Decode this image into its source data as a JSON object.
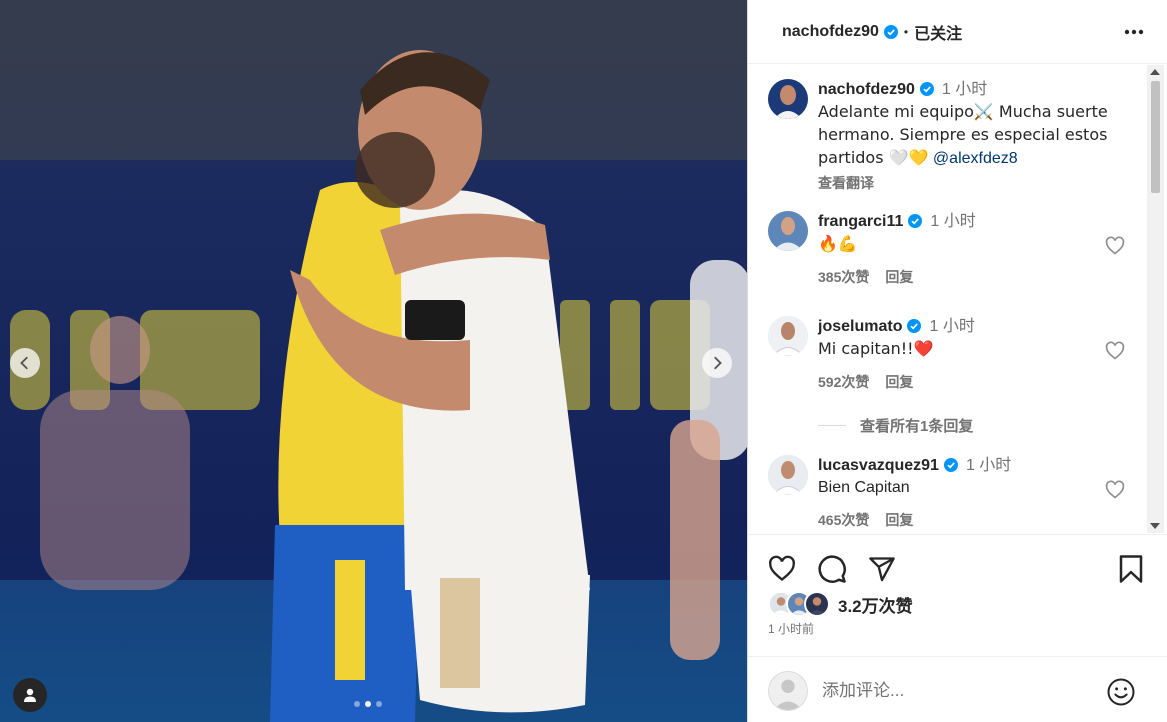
{
  "header": {
    "username": "nachofdez90",
    "separator": "•",
    "follow_state": "已关注"
  },
  "caption": {
    "username": "nachofdez90",
    "time": "1 小时",
    "text": "Adelante mi equipo⚔️ Mucha suerte hermano. Siempre es especial estos partidos 🤍💛",
    "mention": "@alexfdez8",
    "translate_label": "查看翻译"
  },
  "comments": [
    {
      "username": "frangarci11",
      "time": "1 小时",
      "text": "🔥💪",
      "likes": "385次赞",
      "reply_label": "回复"
    },
    {
      "username": "joselumato",
      "time": "1 小时",
      "text": "Mi capitan!!❤️",
      "likes": "592次赞",
      "reply_label": "回复"
    },
    {
      "username": "lucasvazquez91",
      "time": "1 小时",
      "text": "Bien Capitan",
      "likes": "465次赞",
      "reply_label": "回复"
    }
  ],
  "view_replies_label": "查看所有1条回复",
  "post": {
    "likes": "3.2万次赞",
    "time": "1 小时前"
  },
  "comment_input": {
    "placeholder": "添加评论..."
  },
  "colors": {
    "verified": "#0095f6",
    "link": "#00376b",
    "muted": "#737373"
  },
  "icons": [
    "more-options-icon",
    "verified-icon",
    "heart-icon",
    "comment-icon",
    "share-icon",
    "bookmark-icon",
    "emoji-icon",
    "user-tag-icon",
    "chevron-left-icon",
    "chevron-right-icon"
  ]
}
